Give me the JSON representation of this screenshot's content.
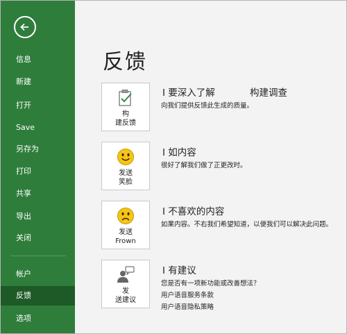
{
  "sidebar": {
    "items": [
      {
        "label": "信息"
      },
      {
        "label": "新建"
      },
      {
        "label": "打开"
      },
      {
        "label": "Save"
      },
      {
        "label": "另存为"
      },
      {
        "label": "打印"
      },
      {
        "label": "共享"
      },
      {
        "label": "导出"
      },
      {
        "label": "关闭"
      },
      {
        "label": "帐户"
      },
      {
        "label": "反馈"
      },
      {
        "label": "选项"
      }
    ],
    "selected": "反馈"
  },
  "main": {
    "title": "反馈",
    "sections": [
      {
        "tile_line1": "构",
        "tile_line2": "建反馈",
        "title": "I 要深入了解",
        "link": "构建调查",
        "desc": "向我们提供反馈此生成的质量。"
      },
      {
        "tile_line1": "发送",
        "tile_line2": "笑脸",
        "title": "I 如内容",
        "desc": "很好了解我们做了正更改时。"
      },
      {
        "tile_line1": "发送",
        "tile_line2": "Frown",
        "title": "I 不喜欢的内容",
        "desc": "如果内容。不右我们希望知道，以便我们可以解决此问题。"
      },
      {
        "tile_line1": "发",
        "tile_line2": "送建议",
        "title": "I 有建议",
        "desc": "您是否有一项新功能或改善想法？",
        "link1": "用户语音服务条款",
        "link2": "用户语音隐私策略"
      }
    ]
  },
  "colors": {
    "sidebar": "#2f7d3b",
    "sidebar_selected": "#1d5a27",
    "smiley": "#f5c518"
  },
  "icons": [
    "back-arrow-icon",
    "clipboard-check-icon",
    "smiley-icon",
    "frown-icon",
    "person-chat-icon"
  ]
}
